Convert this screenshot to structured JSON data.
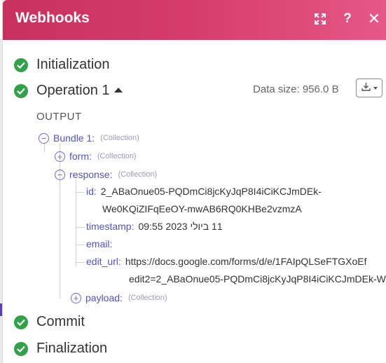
{
  "header": {
    "title": "Webhooks",
    "help_label": "?",
    "close_label": "✕"
  },
  "steps": {
    "initialization": "Initialization",
    "operation": "Operation 1",
    "commit": "Commit",
    "finalization": "Finalization"
  },
  "operation": {
    "data_size": "Data size: 956.0 B"
  },
  "output": {
    "title": "OUTPUT",
    "bundle": {
      "key": "Bundle 1:",
      "type": "(Collection)"
    },
    "form": {
      "key": "form:",
      "type": "(Collection)"
    },
    "response": {
      "key": "response:",
      "type": "(Collection)",
      "fields": {
        "id": {
          "key": "id:",
          "value_line1": "2_ABaOnue05-PQDmCi8jcKyJqP8I4iCiKCJmDEk-",
          "value_line2": "We0KQiZIFqEeOY-mwAB6RQ0KHBe2vzmzA"
        },
        "timestamp": {
          "key": "timestamp:",
          "value": "11 ביולי 2023 09:55"
        },
        "email": {
          "key": "email:",
          "value": ""
        },
        "edit_url": {
          "key": "edit_url:",
          "value_line1": "https://docs.google.com/forms/d/e/1FAIpQLSeFTGXoEf",
          "value_line2": "edit2=2_ABaOnue05-PQDmCi8jcKyJqP8I4iCiKCJmDEk-W"
        }
      }
    },
    "payload": {
      "key": "payload:",
      "type": "(Collection)"
    }
  },
  "colors": {
    "header_start": "#c8305f",
    "header_end": "#e65787",
    "success": "#31a14a",
    "tree_key": "#5152c9"
  },
  "icons": {
    "expand": "expand-icon",
    "help": "help-icon",
    "close": "close-icon",
    "check": "check-icon",
    "download": "download-icon",
    "collapse": "minus-circle-icon",
    "expand_node": "plus-circle-icon"
  }
}
